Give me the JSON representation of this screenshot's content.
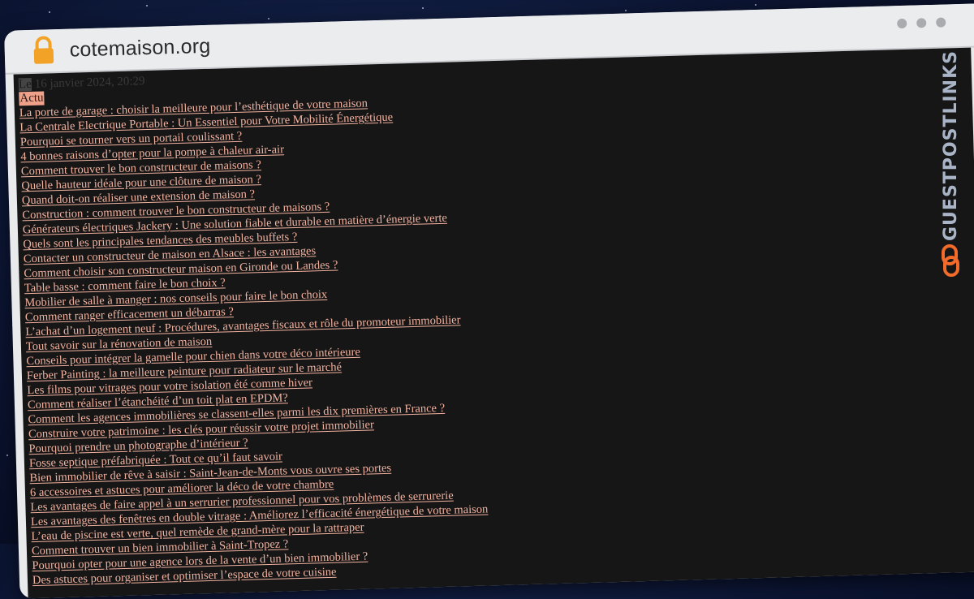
{
  "browser": {
    "url": "cotemaison.org",
    "icons": {
      "lock": "lock-icon",
      "window_controls": "three-dots-icon"
    },
    "accent": "#f2a227"
  },
  "page": {
    "date_prefix": "Le",
    "date": "16 janvier 2024, 20:29",
    "category": "Actu",
    "link_color": "#f2b2a0",
    "category_bg": "#f0a18a",
    "articles": [
      "La porte de garage : choisir la meilleure pour l’esthétique de votre maison",
      "La Centrale Electrique Portable : Un Essentiel pour Votre Mobilité Énergétique",
      "Pourquoi se tourner vers un portail coulissant ?",
      "4 bonnes raisons d’opter pour la pompe à chaleur air-air",
      "Comment trouver le bon constructeur de maisons ?",
      "Quelle hauteur idéale pour une clôture de maison ?",
      "Quand doit-on réaliser une extension de maison ?",
      "Construction : comment trouver le bon constructeur de maisons ?",
      "Générateurs électriques Jackery : Une solution fiable et durable en matière d’énergie verte",
      "Quels sont les principales tendances des meubles buffets ?",
      "Contacter un constructeur de maison en Alsace : les avantages",
      "Comment choisir son constructeur maison en Gironde ou Landes ?",
      "Table basse : comment faire le bon choix ?",
      "Mobilier de salle à manger : nos conseils pour faire le bon choix",
      "Comment ranger efficacement un débarras ?",
      "L’achat d’un logement neuf : Procédures, avantages fiscaux et rôle du promoteur immobilier",
      "Tout savoir sur la rénovation de maison",
      "Conseils pour intégrer la gamelle pour chien dans votre déco intérieure",
      "Ferber Painting : la meilleure peinture pour radiateur sur le marché",
      "Les films pour vitrages pour votre isolation été comme hiver",
      "Comment réaliser l’étanchéité d’un toit plat en EPDM?",
      "Comment les agences immobilières se classent-elles parmi les dix premières en France ?",
      "Construire votre patrimoine : les clés pour réussir votre projet immobilier",
      "Pourquoi prendre un photographe d’intérieur ?",
      "Fosse septique préfabriquée : Tout ce qu’il faut savoir",
      "Bien immobilier de rêve à saisir : Saint-Jean-de-Monts vous ouvre ses portes",
      "6 accessoires et astuces pour améliorer la déco de votre chambre",
      "Les avantages de faire appel à un serrurier professionnel pour vos problèmes de serrurerie",
      "Les avantages des fenêtres en double vitrage : Améliorez l’efficacité énergétique de votre maison",
      "L’eau de piscine est verte, quel remède de grand-mère pour la rattraper",
      "Comment trouver un bien immobilier à Saint-Tropez ?",
      "Pourquoi opter pour une agence lors de la vente d’un bien immobilier ?",
      "Des astuces pour organiser et optimiser l’espace de votre cuisine"
    ]
  },
  "watermark": {
    "text": "GUESTPOSTLINKS",
    "icon": "chain-link-icon",
    "icon_color": "#f26b2a"
  }
}
